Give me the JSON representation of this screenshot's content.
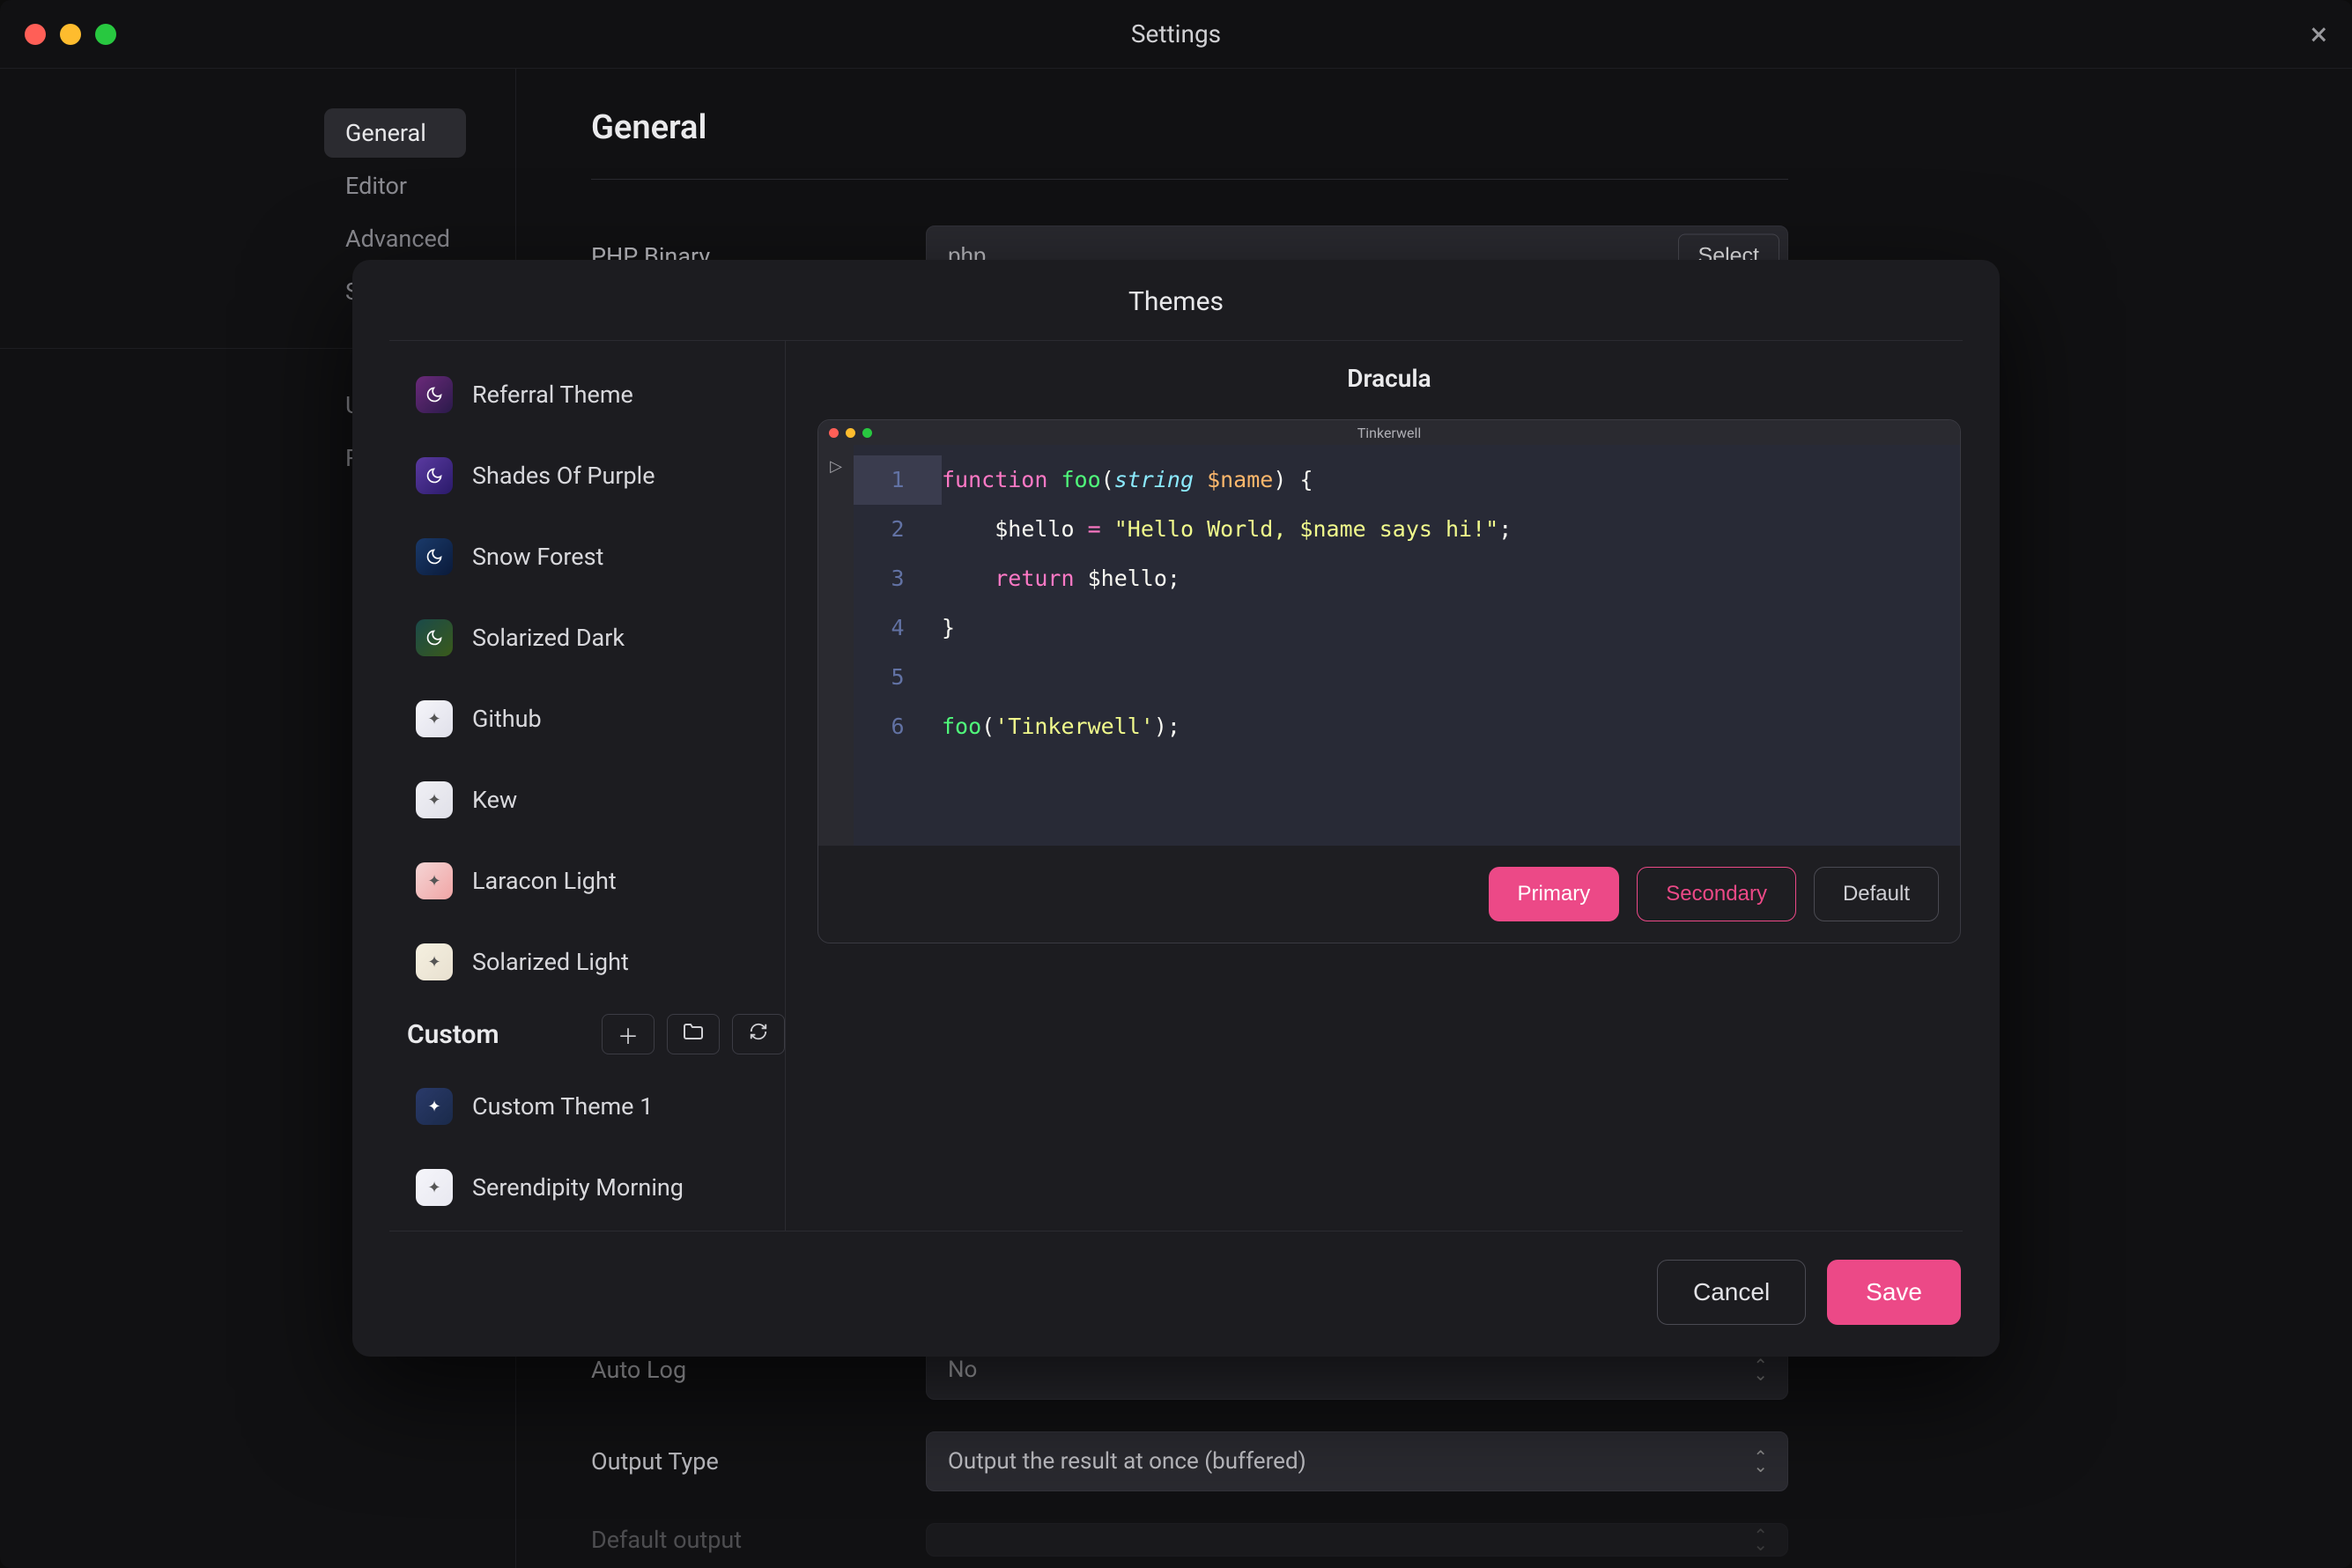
{
  "window": {
    "title": "Settings"
  },
  "sidebar": {
    "items": [
      {
        "label": "General"
      },
      {
        "label": "Editor"
      },
      {
        "label": "Advanced"
      },
      {
        "label": "S"
      },
      {
        "label": "U"
      },
      {
        "label": "R"
      }
    ]
  },
  "main": {
    "heading": "General",
    "rows": {
      "php_binary": {
        "label": "PHP Binary",
        "value": "php",
        "button": "Select"
      },
      "auto_log": {
        "label": "Auto Log",
        "value": "No"
      },
      "output_type": {
        "label": "Output Type",
        "value": "Output the result at once (buffered)"
      },
      "default_output": {
        "label": "Default output"
      }
    }
  },
  "modal": {
    "title": "Themes",
    "themes": [
      {
        "label": "Referral Theme",
        "bg": "linear-gradient(135deg,#6b2a7a,#2a1a4a)",
        "icon": "moon"
      },
      {
        "label": "Shades Of Purple",
        "bg": "linear-gradient(135deg,#5a3aa0,#2a1a6a)",
        "icon": "moon"
      },
      {
        "label": "Snow Forest",
        "bg": "linear-gradient(135deg,#1a3a6a,#0a1a3a)",
        "icon": "moon"
      },
      {
        "label": "Solarized Dark",
        "bg": "linear-gradient(135deg,#1a4a4a,#3a5a1a)",
        "icon": "moon"
      },
      {
        "label": "Github",
        "bg": "linear-gradient(135deg,#f5f5fa,#e0e0ea)",
        "icon": "sparkle",
        "light": true
      },
      {
        "label": "Kew",
        "bg": "linear-gradient(135deg,#f0f0f5,#e0e0e8)",
        "icon": "sparkle",
        "light": true
      },
      {
        "label": "Laracon Light",
        "bg": "linear-gradient(135deg,#f5d5d5,#f0a5a5)",
        "icon": "sparkle",
        "light": true
      },
      {
        "label": "Solarized Light",
        "bg": "linear-gradient(135deg,#f5f0e0,#e8e0d0)",
        "icon": "sparkle",
        "light": true
      }
    ],
    "custom_header": "Custom",
    "custom_themes": [
      {
        "label": "Custom Theme 1",
        "bg": "linear-gradient(135deg,#2a3a6a,#1a2a4a)",
        "icon": "sparkle"
      },
      {
        "label": "Serendipity Morning",
        "bg": "linear-gradient(135deg,#f5f5fa,#e8e8f0)",
        "icon": "sparkle",
        "light": true
      }
    ],
    "preview": {
      "name": "Dracula",
      "editor_title": "Tinkerwell",
      "buttons": {
        "primary": "Primary",
        "secondary": "Secondary",
        "default": "Default"
      },
      "code": {
        "l1": {
          "kw": "function",
          "fn": "foo",
          "p1": "(",
          "type": "string",
          "var": "$name",
          "p2": ") {"
        },
        "l2": {
          "var": "$hello",
          "op": "=",
          "str": "\"Hello World, $name says hi!\"",
          "p": ";"
        },
        "l3": {
          "kw": "return",
          "var": "$hello",
          "p": ";"
        },
        "l4": {
          "p": "}"
        },
        "l6": {
          "fn": "foo",
          "p1": "(",
          "str": "'Tinkerwell'",
          "p2": ");"
        },
        "line_numbers": [
          "1",
          "2",
          "3",
          "4",
          "5",
          "6"
        ]
      }
    },
    "footer": {
      "cancel": "Cancel",
      "save": "Save"
    }
  }
}
